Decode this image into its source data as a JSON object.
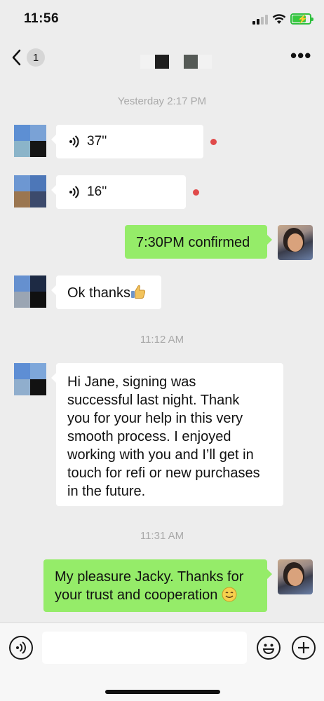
{
  "status_bar": {
    "time": "11:56"
  },
  "nav": {
    "back_count": "1"
  },
  "messages": {
    "timestamp_1": "Yesterday 2:17 PM",
    "voice_1_duration": "37''",
    "voice_2_duration": "16''",
    "outgoing_1": "7:30PM confirmed",
    "incoming_1": "Ok thanks",
    "timestamp_2": "11:12 AM",
    "incoming_2_lines": [
      "Hi Jane, signing was",
      "successful last night. Thank",
      "you for your help in this very",
      "smooth process. I enjoyed",
      "working with you and I’ll get in",
      "touch for refi or new purchases",
      "in the future."
    ],
    "timestamp_3": "11:31 AM",
    "outgoing_2_lines": [
      "My pleasure Jacky. Thanks for",
      "your trust and cooperation"
    ]
  },
  "input_bar": {
    "placeholder": ""
  },
  "colors": {
    "background": "#ededed",
    "outgoing_bubble": "#95ec69",
    "incoming_bubble": "#ffffff",
    "unread_dot": "#e04a4a",
    "timestamp_text": "#a9a9a9"
  },
  "icons": {
    "voice_input": "voice-icon",
    "emoji": "emoji-icon",
    "add": "plus-icon",
    "more": "more-icon",
    "back": "chevron-left-icon"
  }
}
